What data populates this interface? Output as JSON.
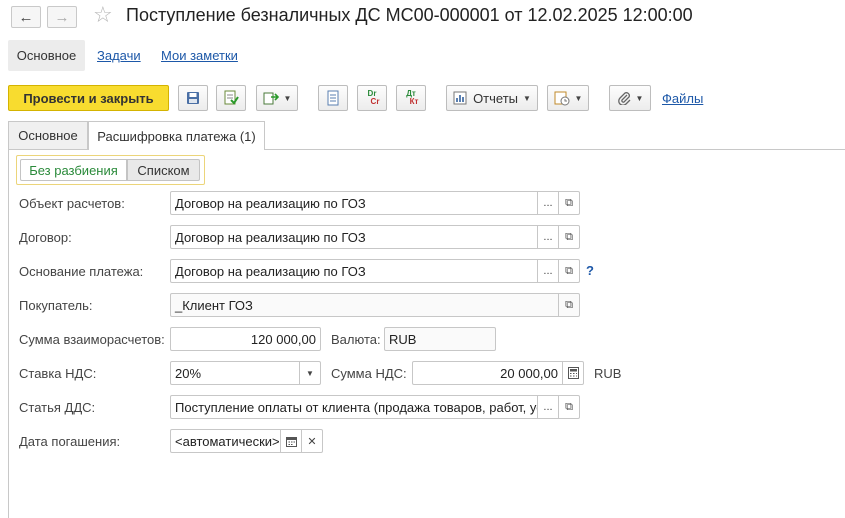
{
  "window": {
    "title": "Поступление безналичных ДС МС00-000001 от 12.02.2025 12:00:00"
  },
  "topnav": {
    "main": "Основное",
    "tasks": "Задачи",
    "notes": "Мои заметки"
  },
  "toolbar": {
    "post_close": "Провести и закрыть",
    "reports": "Отчеты",
    "files": "Файлы",
    "dt_kt_label_dr": "Dr",
    "dt_kt_label_cr": "Cr",
    "dt_label": "Дт",
    "kt_label": "Кт"
  },
  "tabs": [
    {
      "label": "Основное"
    },
    {
      "label": "Расшифровка платежа (1)"
    }
  ],
  "switch": {
    "no_split": "Без разбиения",
    "list": "Списком"
  },
  "form": {
    "settlement_object": {
      "label": "Объект расчетов:",
      "value": "Договор на реализацию по ГОЗ"
    },
    "contract": {
      "label": "Договор:",
      "value": "Договор на реализацию по ГОЗ"
    },
    "payment_basis": {
      "label": "Основание платежа:",
      "value": "Договор на реализацию по ГОЗ",
      "help": "?"
    },
    "buyer": {
      "label": "Покупатель:",
      "value": "_Клиент ГОЗ"
    },
    "settlement_amount": {
      "label": "Сумма взаиморасчетов:",
      "value": "120 000,00"
    },
    "currency": {
      "label": "Валюта:",
      "value": "RUB"
    },
    "vat_rate": {
      "label": "Ставка НДС:",
      "value": "20%"
    },
    "vat_amount": {
      "label": "Сумма НДС:",
      "value": "20 000,00",
      "currency": "RUB"
    },
    "cash_flow_item": {
      "label": "Статья ДДС:",
      "value": "Поступление оплаты от клиента (продажа товаров, работ, ус"
    },
    "due_date": {
      "label": "Дата погашения:",
      "value": "<автоматически>"
    }
  }
}
